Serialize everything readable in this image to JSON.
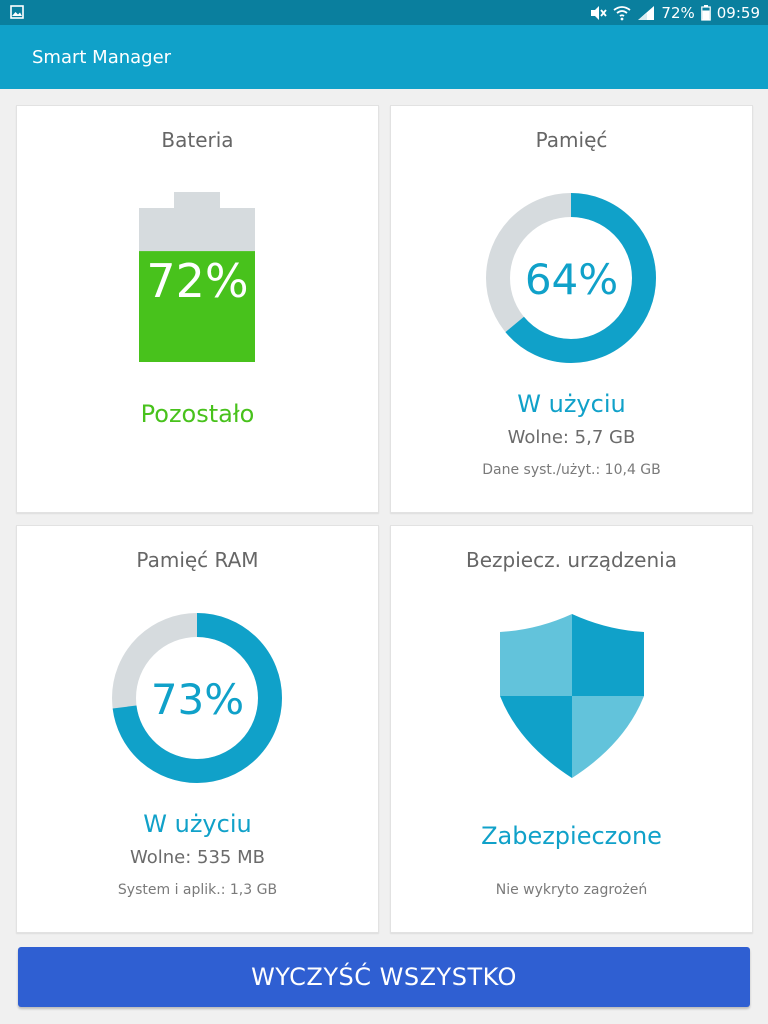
{
  "status_bar": {
    "battery_percent": "72%",
    "time": "09:59"
  },
  "app": {
    "title": "Smart Manager"
  },
  "battery": {
    "title": "Bateria",
    "percent": "72%",
    "status": "Pozostało",
    "level": 0.72,
    "color": "#48c21c",
    "empty_color": "#d6dbde"
  },
  "storage": {
    "title": "Pamięć",
    "percent": "64%",
    "status": "W użyciu",
    "free": "Wolne: 5,7 GB",
    "system": "Dane syst./użyt.: 10,4 GB",
    "level": 0.64,
    "color": "#10a1c9",
    "empty_color": "#d6dbde"
  },
  "ram": {
    "title": "Pamięć RAM",
    "percent": "73%",
    "status": "W użyciu",
    "free": "Wolne: 535 MB",
    "system": "System i aplik.: 1,3 GB",
    "level": 0.73,
    "color": "#10a1c9",
    "empty_color": "#d6dbde"
  },
  "security": {
    "title": "Bezpiecz. urządzenia",
    "status": "Zabezpieczone",
    "detail": "Nie wykryto zagrożeń",
    "dark_color": "#10a1c9",
    "light_color": "#62c3db"
  },
  "actions": {
    "clean_all": "WYCZYŚĆ WSZYSTKO"
  }
}
